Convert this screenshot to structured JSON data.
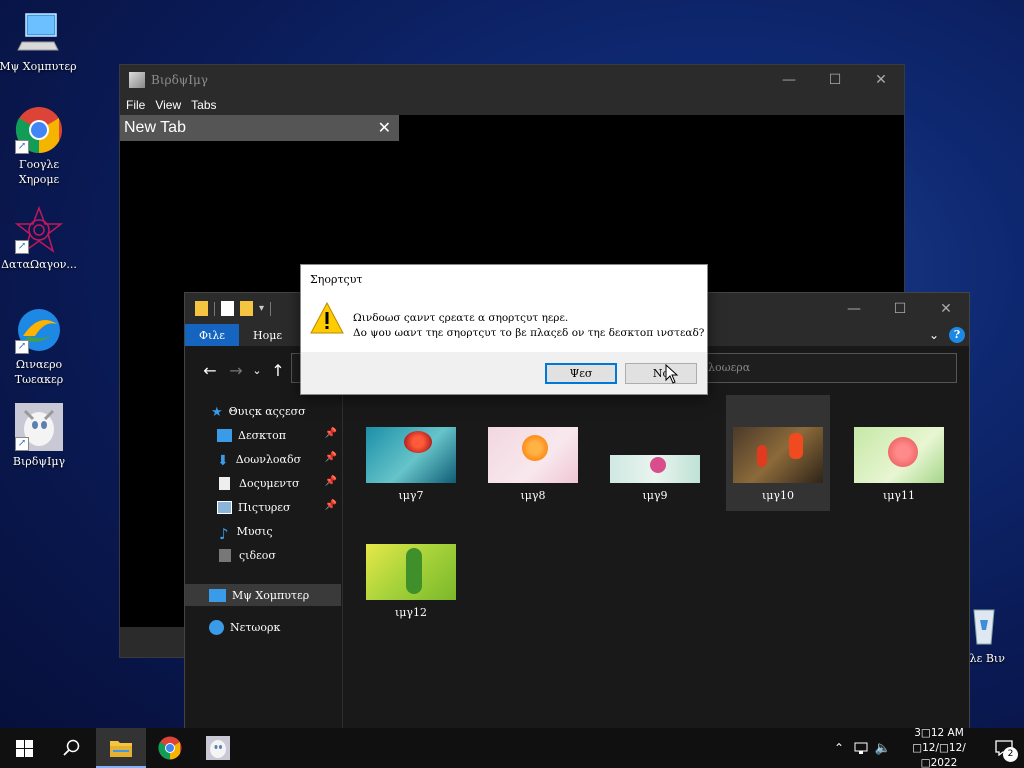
{
  "desktop": {
    "icons": [
      {
        "label_line1": "Μψ Χομπυτερ",
        "label_line2": ""
      },
      {
        "label_line1": "Γοογλε",
        "label_line2": "Χηρομε"
      },
      {
        "label_line1": "ΔαταΩαγον...",
        "label_line2": ""
      },
      {
        "label_line1": "Ωιναερο",
        "label_line2": "Τωεακερ"
      },
      {
        "label_line1": "ΒιρδψΙμγ",
        "label_line2": ""
      }
    ],
    "recycle_bin_label": "γλε Βιν"
  },
  "viewer": {
    "title": "ΒιρδψΙμγ",
    "menu": [
      "File",
      "View",
      "Tabs"
    ],
    "tab_label": "New Tab",
    "tab_close": "✕"
  },
  "explorer": {
    "ribbon_tabs": {
      "file": "Φιλε",
      "home": "Ηομε"
    },
    "search_placeholder": "λοωερα",
    "nav": {
      "quick_access": "Θυιςκ αςςεσσ",
      "desktop": "Δεσκτοπ",
      "downloads": "Δοωνλοαδσ",
      "documents": "Δοςυμεντσ",
      "pictures": "Πιςτυρεσ",
      "music": "Μυσις",
      "videos": "ςιδεοσ",
      "my_computer": "Μψ Χομπυτερ",
      "network": "Νετωορκ"
    },
    "files": [
      {
        "name": "ιμγ7"
      },
      {
        "name": "ιμγ8"
      },
      {
        "name": "ιμγ9"
      },
      {
        "name": "ιμγ10"
      },
      {
        "name": "ιμγ11"
      },
      {
        "name": "ιμγ12"
      }
    ]
  },
  "dialog": {
    "title": "Σηορτςυτ",
    "line1": "Ωινδοωσ ςανντ ςρεατε α σηορτςυτ ηερε.",
    "line2": "Δο ψου ωαντ τηε σηορτςυτ το βε πλαςεδ ον τηε δεσκτοπ ινστεαδ?",
    "yes_label": "Ψεσ",
    "no_label": "Νο"
  },
  "taskbar": {
    "time": "3□12 AM",
    "date": "□12/□12/□2022",
    "notification_count": "2"
  }
}
